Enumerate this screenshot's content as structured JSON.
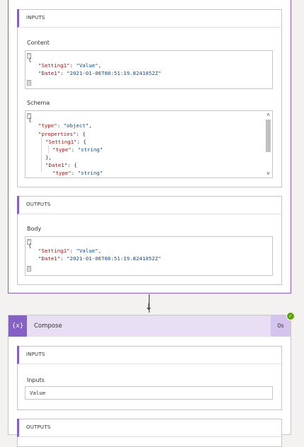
{
  "action1": {
    "inputs_header": "INPUTS",
    "content_label": "Content",
    "content_lines": [
      {
        "key": "\"Setting1\"",
        "sep": ": ",
        "val": "\"Value\"",
        "end": ","
      },
      {
        "key": "\"Date1\"",
        "sep": ": ",
        "val": "\"2021-01-06T08:51:19.8241052Z\"",
        "end": ""
      }
    ],
    "schema_label": "Schema",
    "schema_lines": [
      {
        "key": "\"type\"",
        "sep": ": ",
        "val": "\"object\"",
        "end": ","
      },
      {
        "key": "\"properties\"",
        "sep": ": ",
        "val": "",
        "end": "{"
      },
      {
        "key": "\"Setting1\"",
        "sep": ": ",
        "val": "",
        "end": "{"
      },
      {
        "key": "\"type\"",
        "sep": ": ",
        "val": "\"string\"",
        "end": ""
      },
      {
        "key": "",
        "sep": "",
        "val": "",
        "end": "},"
      },
      {
        "key": "\"Date1\"",
        "sep": ": ",
        "val": "",
        "end": "{"
      },
      {
        "key": "\"type\"",
        "sep": ": ",
        "val": "\"string\"",
        "end": ""
      }
    ],
    "outputs_header": "OUTPUTS",
    "body_label": "Body",
    "body_lines": [
      {
        "key": "\"Setting1\"",
        "sep": ": ",
        "val": "\"Value\"",
        "end": ","
      },
      {
        "key": "\"Date1\"",
        "sep": ": ",
        "val": "\"2021-01-06T08:51:19.8241052Z\"",
        "end": ""
      }
    ]
  },
  "compose": {
    "icon_glyph": "{x}",
    "title": "Compose",
    "duration": "0s",
    "status_icon": "check-icon",
    "status_color": "#57a300",
    "inputs_header": "INPUTS",
    "inputs_label": "Inputs",
    "inputs_value": "Value",
    "outputs_header": "OUTPUTS"
  },
  "colors": {
    "accent": "#8661c5",
    "json_key": "#a31515",
    "json_string": "#0451a5"
  }
}
